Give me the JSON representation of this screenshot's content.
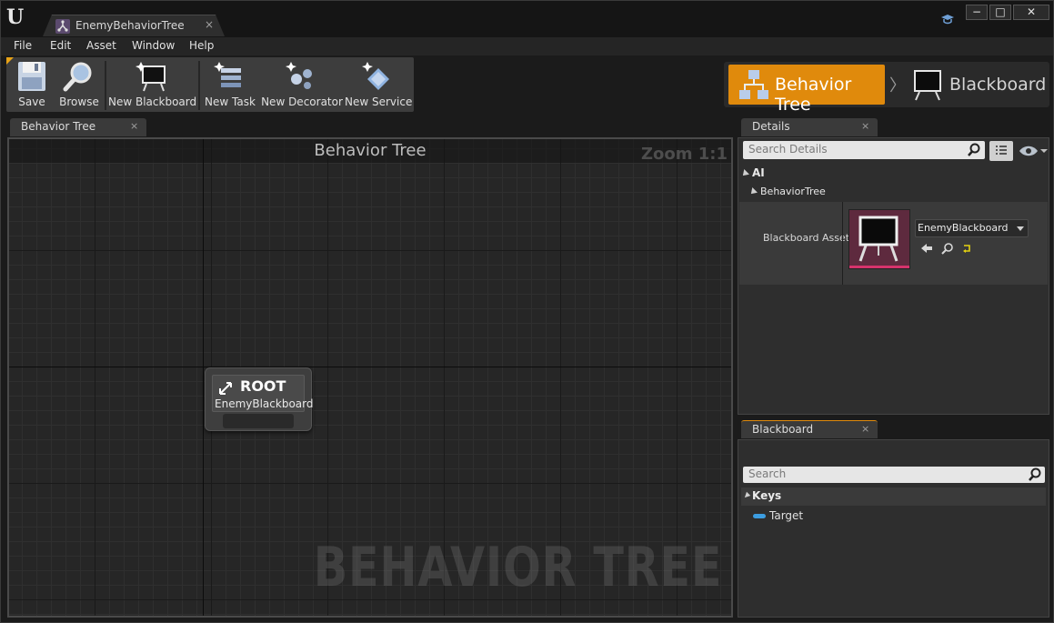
{
  "window": {
    "tab_title": "EnemyBehaviorTree",
    "tab_close": "×",
    "controls": {
      "minimize": "−",
      "maximize": "□",
      "close": "✕"
    }
  },
  "menu": [
    "File",
    "Edit",
    "Asset",
    "Window",
    "Help"
  ],
  "toolbar": {
    "save": "Save",
    "browse": "Browse",
    "new_blackboard": "New Blackboard",
    "new_task": "New Task",
    "new_decorator": "New Decorator",
    "new_service": "New Service"
  },
  "modes": {
    "active": "Behavior Tree",
    "separator": "〉",
    "inactive": "Blackboard",
    "accent": "#e08a0c"
  },
  "graph_tab": {
    "label": "Behavior Tree",
    "close": "×"
  },
  "graph": {
    "title": "Behavior Tree",
    "zoom": "Zoom 1:1",
    "watermark": "BEHAVIOR TREE",
    "root_node": {
      "title": "ROOT",
      "subtitle": "EnemyBlackboard"
    }
  },
  "details": {
    "tab_label": "Details",
    "close": "×",
    "search_placeholder": "Search Details",
    "category": "AI",
    "subcategory": "BehaviorTree",
    "property_name": "Blackboard Asset",
    "property_value": "EnemyBlackboard"
  },
  "blackboard": {
    "tab_label": "Blackboard",
    "close": "×",
    "search_placeholder": "Search",
    "keys_header": "Keys",
    "keys": [
      {
        "name": "Target",
        "color": "#3c9de0"
      }
    ]
  }
}
